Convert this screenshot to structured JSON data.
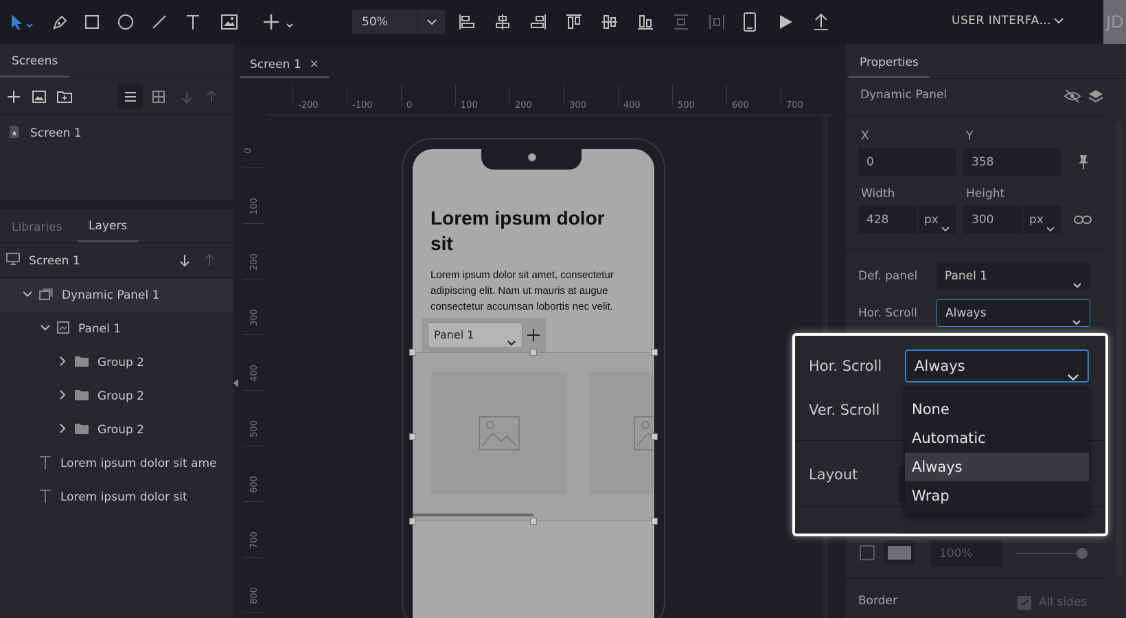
{
  "toolbar": {
    "zoom": "50%",
    "project_name": "USER INTERFA...",
    "avatar_initials": "JD"
  },
  "screens_panel": {
    "tab_label": "Screens",
    "items": [
      {
        "label": "Screen 1"
      }
    ]
  },
  "layers_panel": {
    "tabs": [
      {
        "label": "Libraries"
      },
      {
        "label": "Layers"
      }
    ],
    "root": "Screen 1",
    "items": [
      {
        "label": "Dynamic Panel 1"
      },
      {
        "label": "Panel 1"
      },
      {
        "label": "Group 2"
      },
      {
        "label": "Group 2"
      },
      {
        "label": "Group 2"
      },
      {
        "label": "Lorem ipsum dolor sit ame"
      },
      {
        "label": "Lorem ipsum dolor sit"
      }
    ]
  },
  "canvas": {
    "tab_label": "Screen 1",
    "ruler_h": [
      "-200",
      "-100",
      "0",
      "100",
      "200",
      "300",
      "400",
      "500",
      "600",
      "700"
    ],
    "ruler_v": [
      "0",
      "100",
      "200",
      "300",
      "400",
      "500",
      "600",
      "700",
      "800"
    ],
    "screen_title": "Lorem ipsum dolor sit",
    "screen_body": "Lorem ipsum dolor sit amet, consectetur adipiscing elit. Nam ut mauris at augue consectetur accumsan lobortis nec velit. ...eifend.",
    "panel_selector": "Panel 1"
  },
  "properties": {
    "tab_label": "Properties",
    "element_type": "Dynamic Panel",
    "x_label": "X",
    "x_value": "0",
    "y_label": "Y",
    "y_value": "358",
    "width_label": "Width",
    "width_value": "428",
    "width_unit": "px",
    "height_label": "Height",
    "height_value": "300",
    "height_unit": "px",
    "def_panel_label": "Def. panel",
    "def_panel_value": "Panel 1",
    "hor_scroll_label": "Hor. Scroll",
    "hor_scroll_value": "Always",
    "opacity_value": "100%",
    "border_label": "Border",
    "all_sides_label": "All sides"
  },
  "callout": {
    "hor_scroll_label": "Hor. Scroll",
    "hor_scroll_value": "Always",
    "ver_scroll_label": "Ver. Scroll",
    "layout_label": "Layout",
    "options": [
      {
        "label": "None"
      },
      {
        "label": "Automatic"
      },
      {
        "label": "Always"
      },
      {
        "label": "Wrap"
      }
    ]
  },
  "colors": {
    "accent": "#2f80d0",
    "panel_bg": "#27282c",
    "canvas_bg": "#1e1f22"
  }
}
